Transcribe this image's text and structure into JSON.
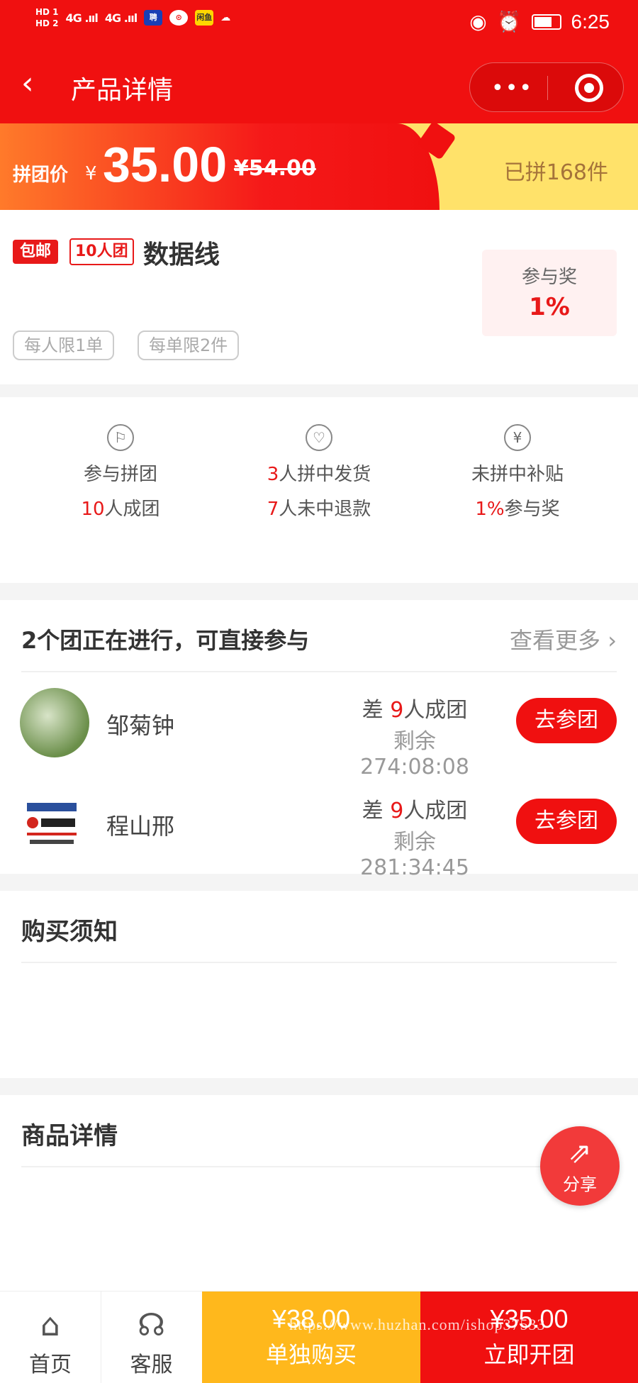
{
  "status_bar": {
    "hd1": "HD 1",
    "hd2": "HD 2",
    "signal1": "4G .ııl",
    "signal2": "4G .ııl",
    "app1": "聘",
    "app2": "⊙",
    "app3": "闲鱼",
    "time": "6:25"
  },
  "nav": {
    "back": "<",
    "title": "产品详情"
  },
  "price_banner": {
    "label": "拼团价",
    "yen": "¥",
    "price": "35.00",
    "original": "¥54.00",
    "sold": "已拼168件"
  },
  "product": {
    "tag_free_shipping": "包邮",
    "tag_group_size": "10人团",
    "name": "数据线",
    "limit_per_person": "每人限1单",
    "limit_per_order": "每单限2件",
    "reward_label": "参与奖",
    "reward_value": "1%"
  },
  "rules": [
    {
      "line1": "参与拼团",
      "line2_red": "10",
      "line2": "人成团"
    },
    {
      "line1_red": "3",
      "line1": "人拼中发货",
      "line2_red": "7",
      "line2": "人未中退款"
    },
    {
      "line1": "未拼中补贴",
      "line2_red": "1%",
      "line2": "参与奖"
    }
  ],
  "groups": {
    "title": "2个团正在进行，可直接参与",
    "more": "查看更多",
    "items": [
      {
        "name": "邹菊钟",
        "need_prefix": "差",
        "need_count": "9",
        "need_suffix": "人成团",
        "remain": "剩余274:08:08",
        "button": "去参团"
      },
      {
        "name": "程山邢",
        "need_prefix": "差",
        "need_count": "9",
        "need_suffix": "人成团",
        "remain": "剩余281:34:45",
        "button": "去参团"
      }
    ]
  },
  "notice": {
    "title": "购买须知"
  },
  "details": {
    "title": "商品详情"
  },
  "share": {
    "label": "分享"
  },
  "bottom_bar": {
    "home": "首页",
    "service": "客服",
    "single_price": "¥38.00",
    "single_label": "单独购买",
    "group_price": "¥35.00",
    "group_label": "立即开团"
  },
  "watermark": "https://www.huzhan.com/ishop37533",
  "colors": {
    "primary_red": "#f01010",
    "banner_yellow": "#ffe26a",
    "single_buy_yellow": "#ffb81c"
  }
}
